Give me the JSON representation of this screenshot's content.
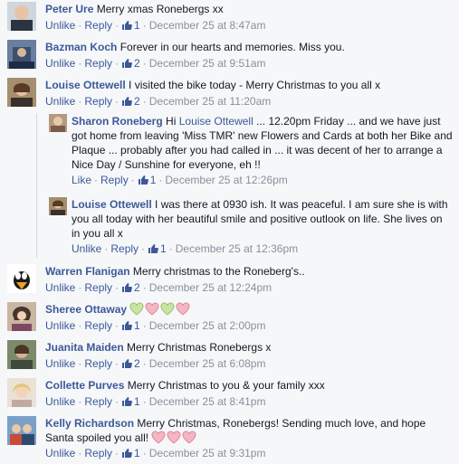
{
  "comments": [
    {
      "name": "Peter Ure",
      "text": "Merry xmas Ronebergs xx",
      "action": "Unlike",
      "reply": "Reply",
      "likes": "1",
      "time": "December 25 at 8:47am"
    },
    {
      "name": "Bazman Koch",
      "text": "Forever in our hearts and memories. Miss you.",
      "action": "Unlike",
      "reply": "Reply",
      "likes": "2",
      "time": "December 25 at 9:51am"
    },
    {
      "name": "Louise Ottewell",
      "text": "I visited the bike today - Merry Christmas to you all x",
      "action": "Unlike",
      "reply": "Reply",
      "likes": "2",
      "time": "December 25 at 11:20am"
    },
    {
      "name": "Warren Flanigan",
      "text": "Merry christmas to the Roneberg's..",
      "action": "Unlike",
      "reply": "Reply",
      "likes": "2",
      "time": "December 25 at 12:24pm"
    },
    {
      "name": "Sheree Ottaway",
      "text": "",
      "hearts": [
        "green",
        "pink",
        "green",
        "pink"
      ],
      "action": "Unlike",
      "reply": "Reply",
      "likes": "1",
      "time": "December 25 at 2:00pm"
    },
    {
      "name": "Juanita Maiden",
      "text": "Merry Christmas Ronebergs x",
      "action": "Unlike",
      "reply": "Reply",
      "likes": "2",
      "time": "December 25 at 6:08pm"
    },
    {
      "name": "Collette Purves",
      "text": "Merry Christmas to you & your family xxx",
      "action": "Unlike",
      "reply": "Reply",
      "likes": "1",
      "time": "December 25 at 8:41pm"
    },
    {
      "name": "Kelly Richardson",
      "text": "Merry Christmas, Ronebergs! Sending much love, and hope Santa spoiled you all!",
      "hearts": [
        "pink",
        "pink",
        "pink"
      ],
      "action": "Unlike",
      "reply": "Reply",
      "likes": "1",
      "time": "December 25 at 9:31pm"
    }
  ],
  "replies": [
    {
      "name": "Sharon Roneberg",
      "pre": "Hi",
      "mention": "Louise Ottewell",
      "text": "... 12.20pm Friday ... and we have just got home from leaving 'Miss TMR' new Flowers and Cards at both her Bike and Plaque ... probably after you had called in ... it was decent of her to arrange a Nice Day / Sunshine for everyone, eh !!",
      "action": "Like",
      "reply": "Reply",
      "likes": "1",
      "time": "December 25 at 12:26pm"
    },
    {
      "name": "Louise Ottewell",
      "text": "I was there at 0930 ish. It was peaceful. I am sure she is with you all today with her beautiful smile and positive outlook on life. She lives on in you all x",
      "action": "Unlike",
      "reply": "Reply",
      "likes": "1",
      "time": "December 25 at 12:36pm"
    }
  ],
  "colors": {
    "link": "#3b5998",
    "meta": "#8a8f9c",
    "heart_green": "#c8e6a0",
    "heart_pink": "#f4b6c2"
  }
}
